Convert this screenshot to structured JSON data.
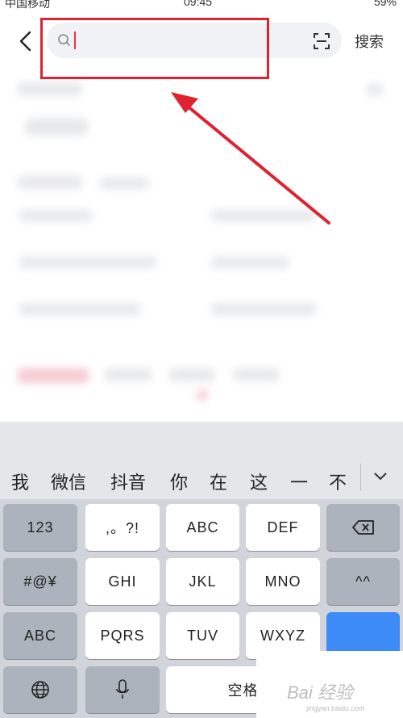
{
  "status_bar": {
    "carrier": "中国移动",
    "time": "09:45",
    "battery": "59%"
  },
  "search": {
    "placeholder": "",
    "search_button": "搜索"
  },
  "candidates": [
    "我",
    "微信",
    "抖音",
    "你",
    "在",
    "这",
    "一",
    "不"
  ],
  "keyboard": {
    "row1": [
      "123",
      ",。?!",
      "ABC",
      "DEF"
    ],
    "row2": [
      "#@¥",
      "GHI",
      "JKL",
      "MNO",
      "^^"
    ],
    "row3": [
      "ABC",
      "PQRS",
      "TUV",
      "WXYZ"
    ],
    "row4": [
      "空格"
    ]
  },
  "watermark": {
    "text": "Bai 经验",
    "url": "jingyan.baidu.com"
  },
  "colors": {
    "highlight": "#e0212f",
    "caret": "#e8374a",
    "return_key": "#3d8bf7"
  }
}
